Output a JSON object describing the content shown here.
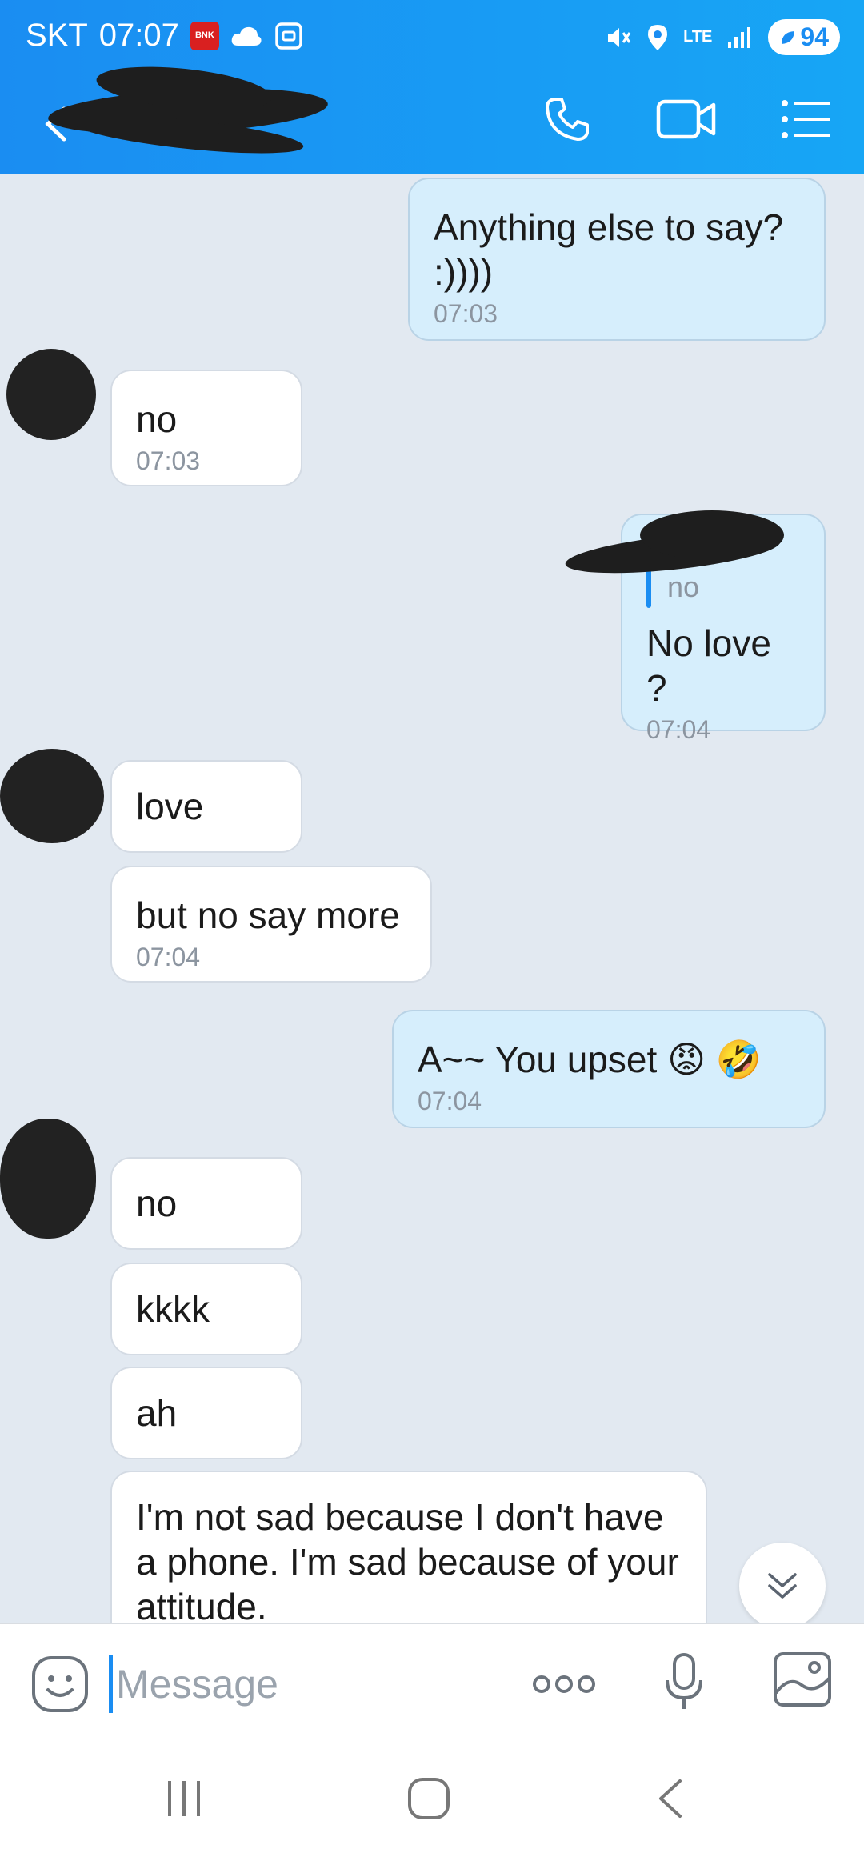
{
  "status_bar": {
    "carrier": "SKT",
    "time": "07:07",
    "app_badge": "BNK",
    "network": "LTE",
    "battery": "94"
  },
  "header": {
    "back_icon": "chevron-left-icon",
    "contact_name_redacted": "",
    "icons": [
      "phone-icon",
      "video-camera-icon",
      "menu-list-icon"
    ]
  },
  "messages": [
    {
      "dir": "out",
      "text": "Anything else to say? :))))",
      "time": "07:03"
    },
    {
      "dir": "in",
      "text": "no",
      "time": "07:03"
    },
    {
      "dir": "out",
      "reply_to": "no",
      "text": "No love ?",
      "time": "07:04"
    },
    {
      "dir": "in",
      "text": "love",
      "time": ""
    },
    {
      "dir": "in",
      "text": "but no say more",
      "time": "07:04"
    },
    {
      "dir": "out",
      "text": "A~~  You upset 😡 🤣",
      "time": "07:04"
    },
    {
      "dir": "in",
      "text": "no",
      "time": ""
    },
    {
      "dir": "in",
      "text": "kkkk",
      "time": ""
    },
    {
      "dir": "in",
      "text": "ah",
      "time": ""
    },
    {
      "dir": "in",
      "text": "I'm not sad because I don't have a phone. I'm sad because of your attitude.",
      "time": ""
    }
  ],
  "input": {
    "placeholder": "Message"
  },
  "colors": {
    "header": "#1a8df2",
    "chat_bg": "#e2e9f1",
    "outgoing_bubble": "#d6eefc",
    "incoming_bubble": "#ffffff"
  }
}
